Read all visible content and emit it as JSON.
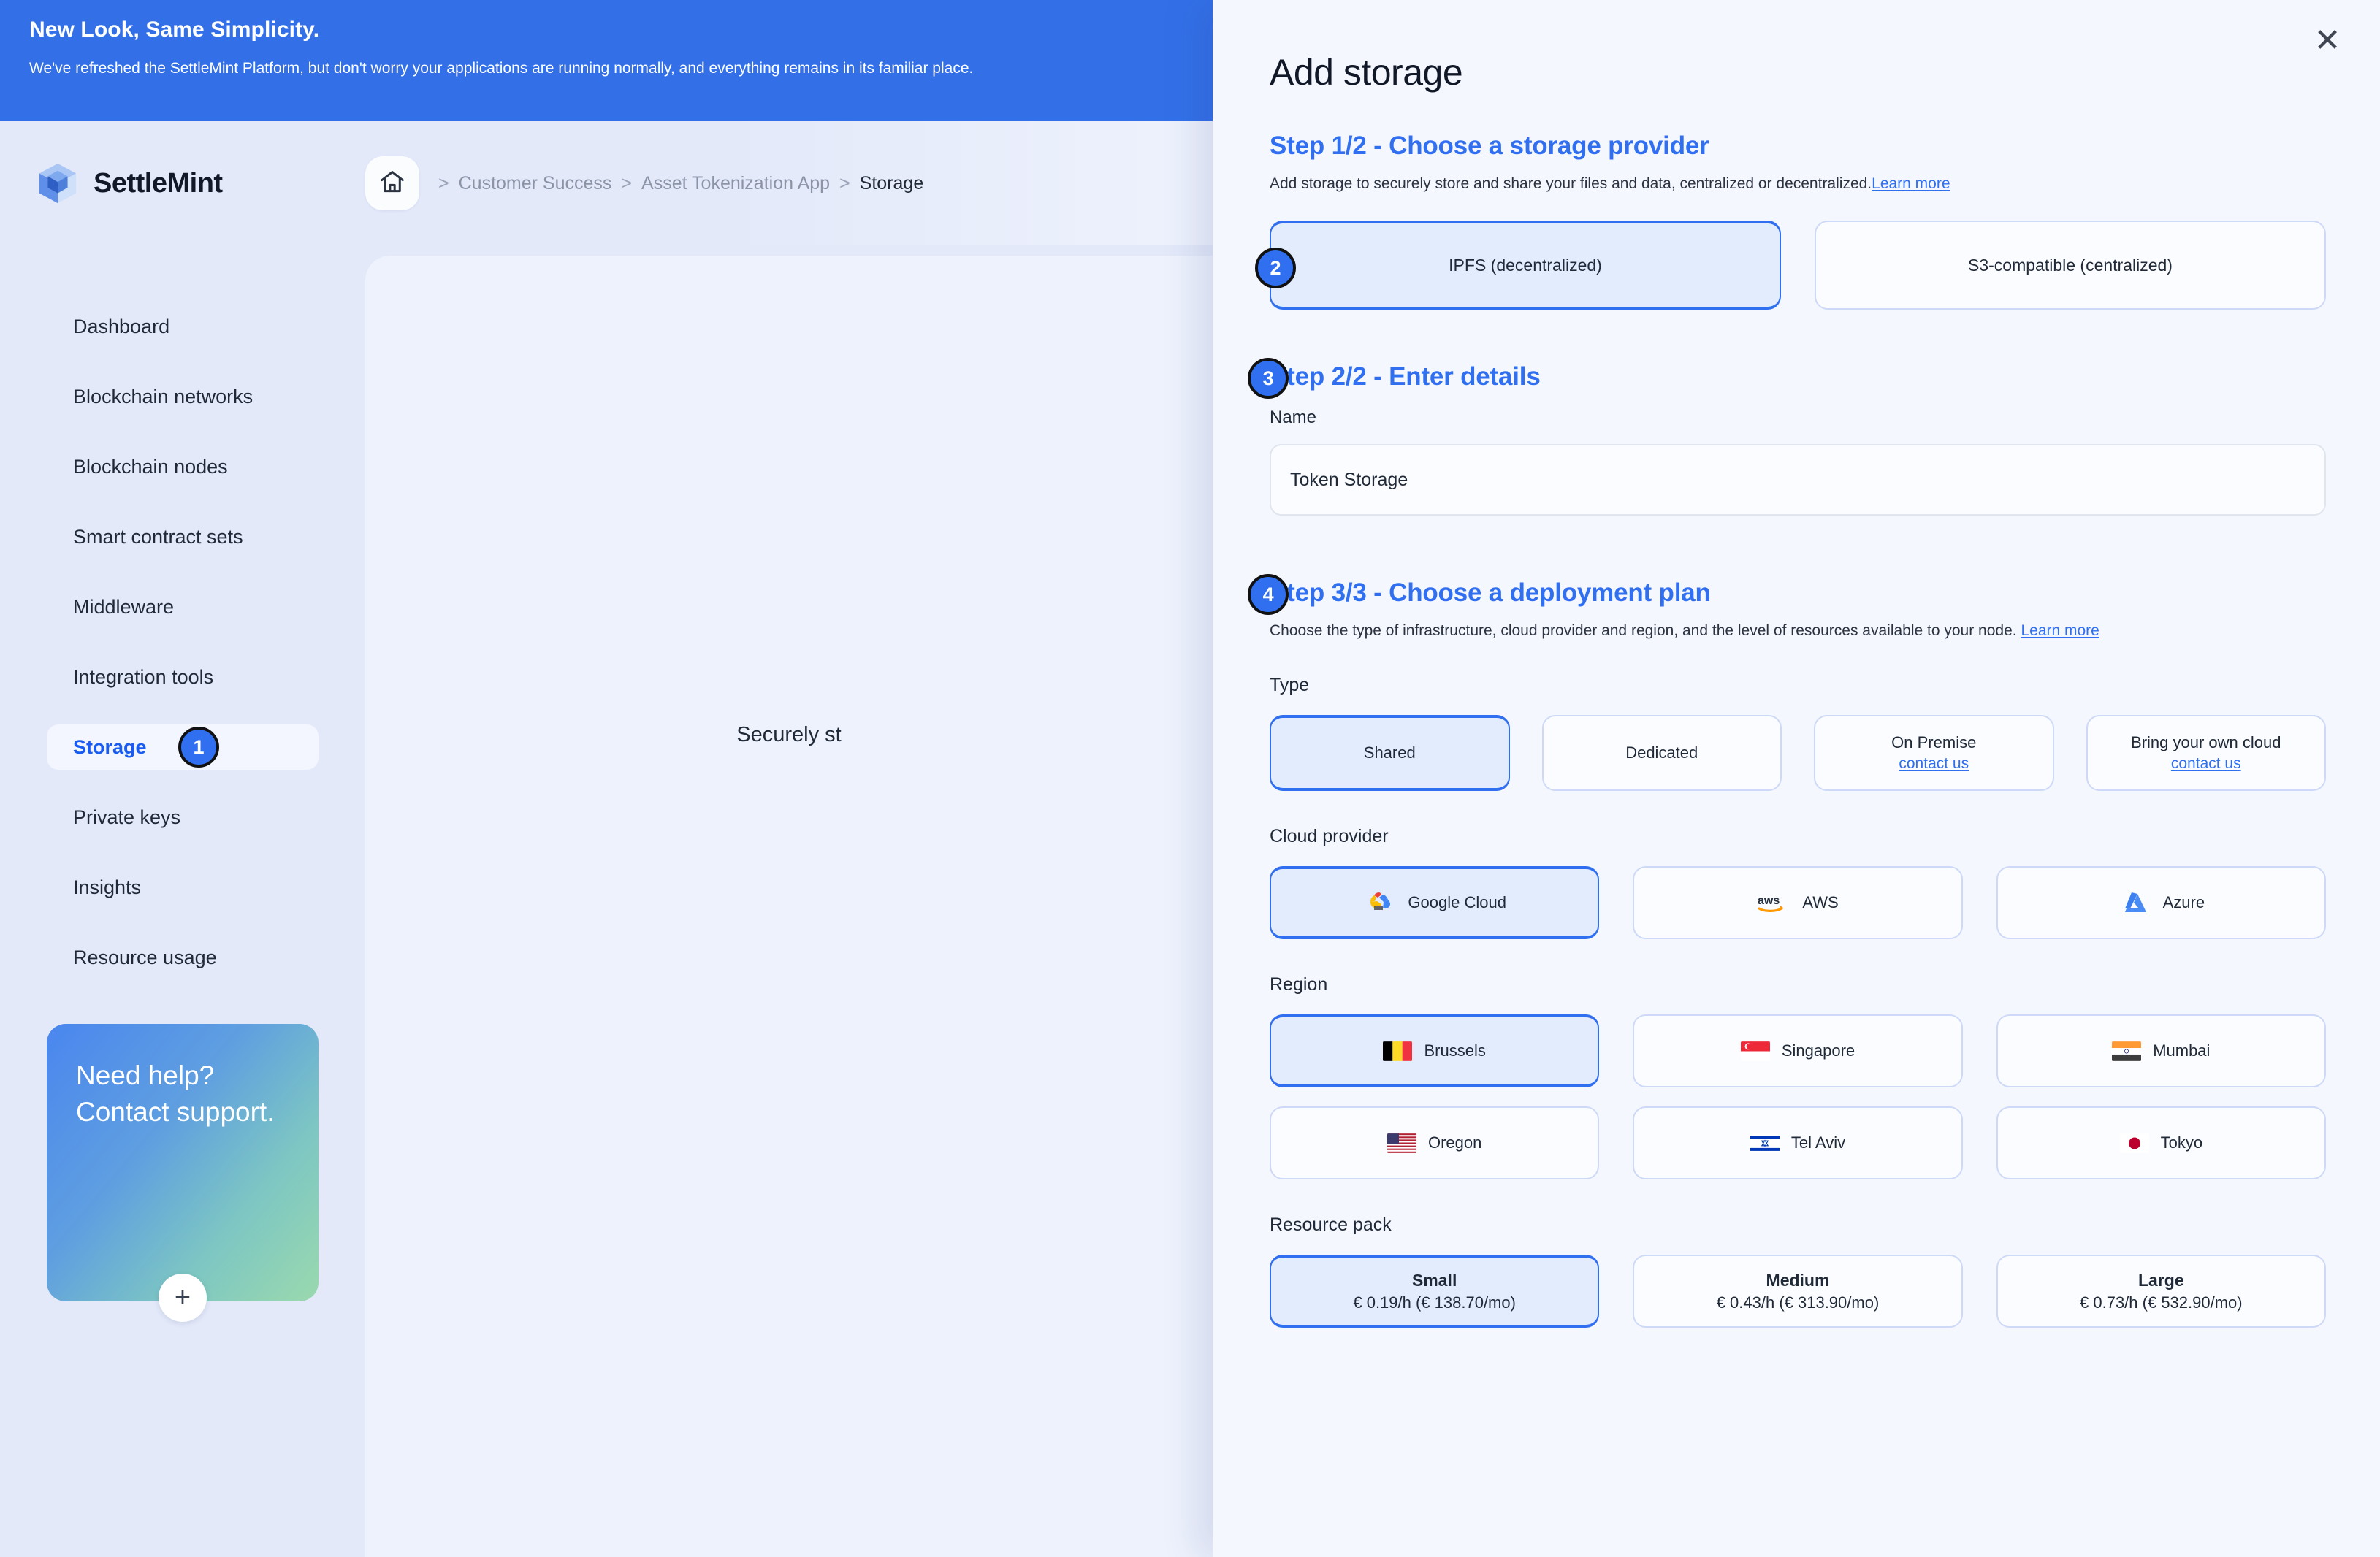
{
  "banner": {
    "title": "New Look, Same Simplicity.",
    "subtitle": "We've refreshed the SettleMint Platform, but don't worry your applications are running normally, and everything remains in its familiar place."
  },
  "brand": {
    "name": "SettleMint",
    "logo_icon": "settlemint-cube-icon"
  },
  "breadcrumb": {
    "home_icon": "home-icon",
    "sep": ">",
    "items": [
      {
        "label": "Customer Success"
      },
      {
        "label": "Asset Tokenization App"
      },
      {
        "label": "Storage"
      }
    ]
  },
  "sidebar": {
    "items": [
      {
        "label": "Dashboard",
        "active": false
      },
      {
        "label": "Blockchain networks",
        "active": false
      },
      {
        "label": "Blockchain nodes",
        "active": false
      },
      {
        "label": "Smart contract sets",
        "active": false
      },
      {
        "label": "Middleware",
        "active": false
      },
      {
        "label": "Integration tools",
        "active": false
      },
      {
        "label": "Storage",
        "active": true,
        "marker": "1"
      },
      {
        "label": "Private keys",
        "active": false
      },
      {
        "label": "Insights",
        "active": false
      },
      {
        "label": "Resource usage",
        "active": false
      }
    ],
    "help_card": {
      "text": "Need help? Contact support.",
      "plus_icon": "plus-icon"
    }
  },
  "background_content": {
    "hero_text": "Securely st"
  },
  "drawer": {
    "close_icon": "close-icon",
    "title": "Add storage",
    "step1": {
      "heading": "Step 1/2 - Choose a storage provider",
      "description": "Add storage to securely store and share your files and data, centralized or decentralized.",
      "learn_more": "Learn more",
      "options": [
        {
          "label": "IPFS (decentralized)",
          "selected": true,
          "marker": "2"
        },
        {
          "label": "S3-compatible (centralized)",
          "selected": false
        }
      ]
    },
    "step2": {
      "marker": "3",
      "heading": "Step 2/2 - Enter details",
      "name_label": "Name",
      "name_value": "Token Storage",
      "name_placeholder": "Name"
    },
    "step3": {
      "marker": "4",
      "heading": "Step 3/3 - Choose a deployment plan",
      "description": "Choose the type of infrastructure, cloud provider and region, and the level of resources available to your node.",
      "learn_more": "Learn more",
      "type_label": "Type",
      "types": [
        {
          "label": "Shared",
          "sub": "",
          "selected": true
        },
        {
          "label": "Dedicated",
          "sub": "",
          "selected": false
        },
        {
          "label": "On Premise",
          "sub": "contact us",
          "selected": false
        },
        {
          "label": "Bring your own cloud",
          "sub": "contact us",
          "selected": false
        }
      ],
      "cloud_label": "Cloud provider",
      "clouds": [
        {
          "label": "Google Cloud",
          "icon": "google-cloud-icon",
          "selected": true
        },
        {
          "label": "AWS",
          "icon": "aws-icon",
          "selected": false
        },
        {
          "label": "Azure",
          "icon": "azure-icon",
          "selected": false
        }
      ],
      "region_label": "Region",
      "regions": [
        {
          "label": "Brussels",
          "icon": "flag-belgium-icon",
          "selected": true
        },
        {
          "label": "Singapore",
          "icon": "flag-singapore-icon",
          "selected": false
        },
        {
          "label": "Mumbai",
          "icon": "flag-india-icon",
          "selected": false
        },
        {
          "label": "Oregon",
          "icon": "flag-usa-icon",
          "selected": false
        },
        {
          "label": "Tel Aviv",
          "icon": "flag-israel-icon",
          "selected": false
        },
        {
          "label": "Tokyo",
          "icon": "flag-japan-icon",
          "selected": false
        }
      ],
      "pack_label": "Resource pack",
      "packs": [
        {
          "name": "Small",
          "price": "€ 0.19/h (€ 138.70/mo)",
          "selected": true
        },
        {
          "name": "Medium",
          "price": "€ 0.43/h (€ 313.90/mo)",
          "selected": false
        },
        {
          "name": "Large",
          "price": "€ 0.73/h (€ 532.90/mo)",
          "selected": false
        }
      ]
    }
  },
  "colors": {
    "accent": "#2f6ff0",
    "banner_blue": "#3370e8",
    "selected_bg": "#e3ecfd"
  }
}
